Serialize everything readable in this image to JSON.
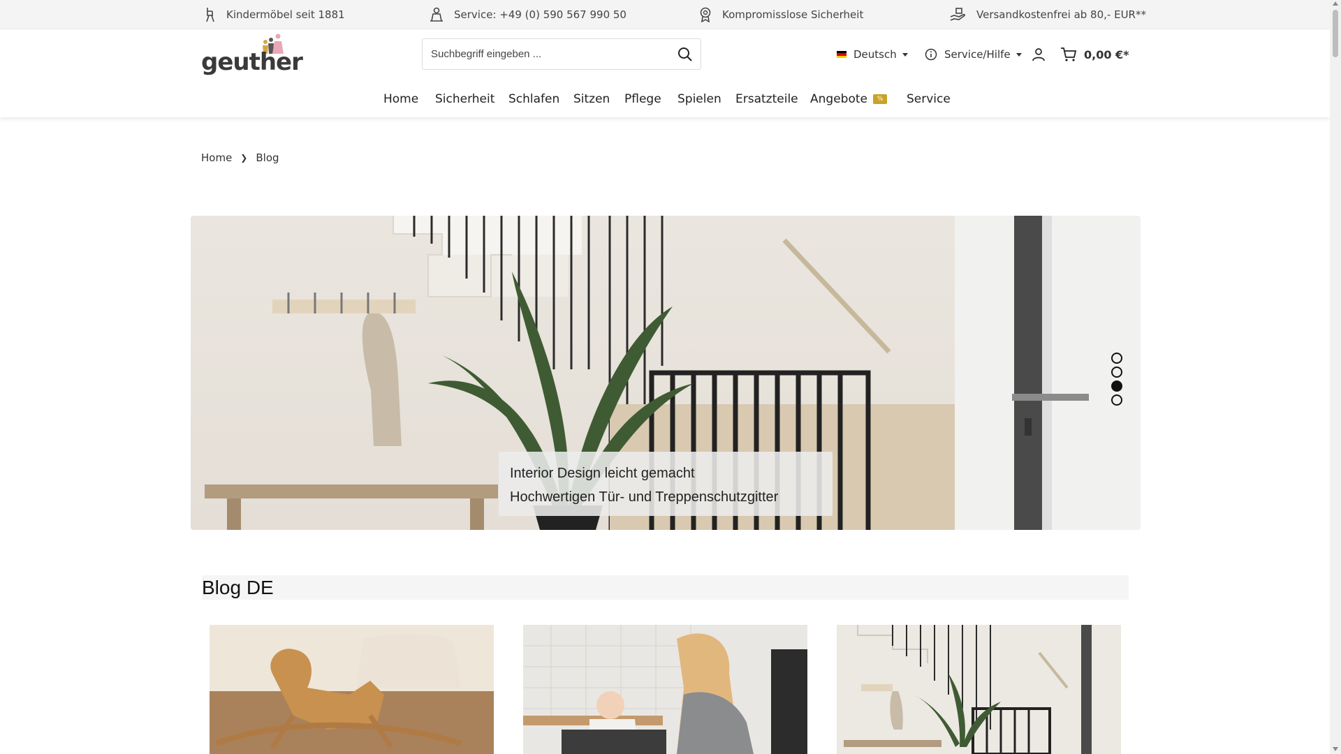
{
  "topbar": {
    "items": [
      {
        "icon": "highchair-icon",
        "text": "Kindermöbel seit 1881"
      },
      {
        "icon": "service-person-icon",
        "text": "Service: +49 (0) 590 567 990 50"
      },
      {
        "icon": "safety-badge-icon",
        "text": "Kompromisslose Sicherheit"
      },
      {
        "icon": "shipping-hand-icon",
        "text": "Versandkostenfrei ab 80,- EUR**"
      }
    ]
  },
  "header": {
    "logo_text": "geuther",
    "search_placeholder": "Suchbegriff eingeben ...",
    "language": "Deutsch",
    "service_help": "Service/Hilfe",
    "cart_total": "0,00 €*"
  },
  "nav": {
    "items": [
      "Home",
      "Sicherheit",
      "Schlafen",
      "Sitzen",
      "Pflege",
      "Spielen",
      "Ersatzteile",
      "Angebote",
      "Service"
    ],
    "offer_badge": "%"
  },
  "breadcrumb": {
    "home": "Home",
    "current": "Blog"
  },
  "hero": {
    "caption_line1": "Interior Design leicht gemacht",
    "caption_line2": "Hochwertigen Tür- und Treppenschutzgitter",
    "slides": 4,
    "active_slide": 3
  },
  "blog": {
    "heading": "Blog DE"
  },
  "colors": {
    "topbar_bg": "#f4f4f4",
    "badge": "#c9a227",
    "logo_accent_pink": "#e9a8b5",
    "logo_accent_gold": "#d9a441"
  }
}
